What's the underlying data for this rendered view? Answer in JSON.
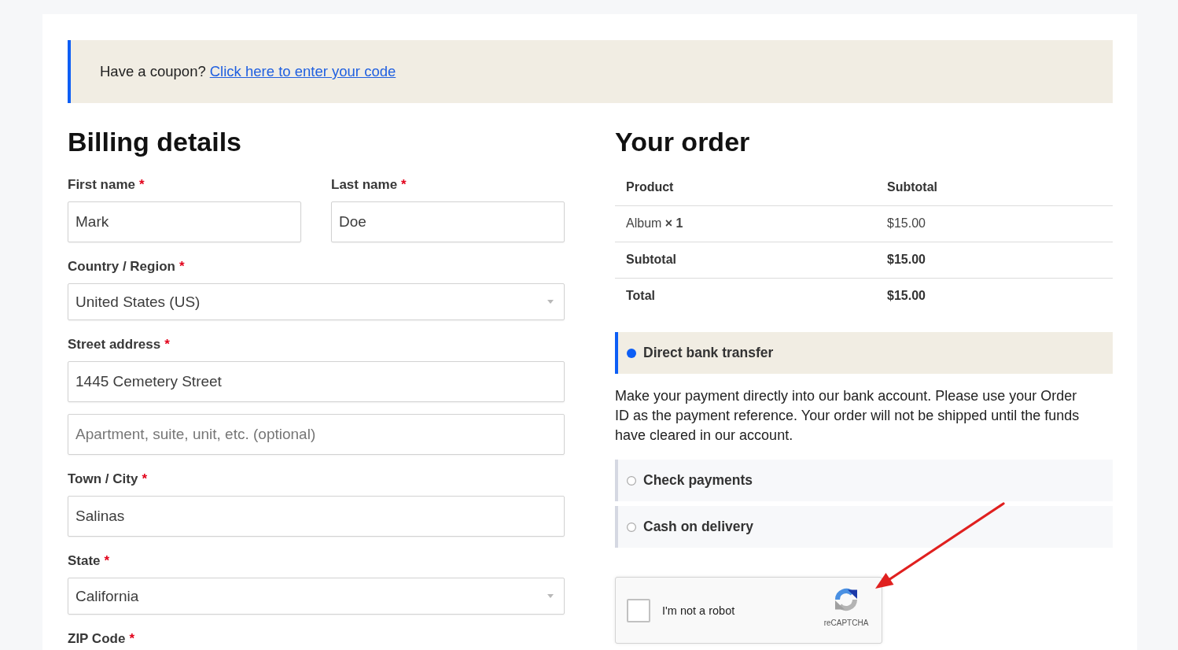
{
  "coupon_notice": {
    "text": "Have a coupon?",
    "link": "Click here to enter your code"
  },
  "billing": {
    "heading": "Billing details",
    "rows": [
      [
        {
          "label": "First name",
          "required_mark": "*",
          "kind": "text",
          "value": "Mark"
        },
        {
          "label": "Last name",
          "required_mark": "*",
          "kind": "text",
          "value": "Doe"
        }
      ],
      [
        {
          "label": "Country / Region",
          "required_mark": "*",
          "kind": "select",
          "value": "United States (US)"
        }
      ],
      [
        {
          "label": "Street address",
          "required_mark": "*",
          "kind": "text",
          "value": "1445 Cemetery Street"
        }
      ],
      [
        {
          "kind": "text",
          "placeholder": "Apartment, suite, unit, etc. (optional)"
        }
      ],
      [
        {
          "label": "Town / City",
          "required_mark": "*",
          "kind": "text",
          "value": "Salinas"
        }
      ],
      [
        {
          "label": "State",
          "required_mark": "*",
          "kind": "select",
          "value": "California"
        }
      ],
      [
        {
          "label": "ZIP Code",
          "required_mark": "*"
        }
      ]
    ]
  },
  "order": {
    "heading": "Your order",
    "table": {
      "columns": [
        "Product",
        "Subtotal"
      ],
      "rows": [
        {
          "kind": "item",
          "product": "Album **× 1**",
          "amount": "$15.00"
        },
        {
          "kind": "subtotal",
          "product": "Subtotal",
          "amount": "$15.00"
        },
        {
          "kind": "total",
          "product": "Total",
          "amount": "$15.00"
        }
      ]
    }
  },
  "payment_methods": [
    {
      "label": "Direct bank transfer",
      "selected": true,
      "description": "Make your payment directly into our bank account. Please use your Order ID as the payment reference. Your order will not be shipped until the funds have cleared in our account."
    },
    {
      "label": "Check payments",
      "selected": false
    },
    {
      "label": "Cash on delivery",
      "selected": false
    }
  ],
  "captcha": {
    "checked": false,
    "label": "I'm not a robot",
    "brand": "reCAPTCHA"
  }
}
